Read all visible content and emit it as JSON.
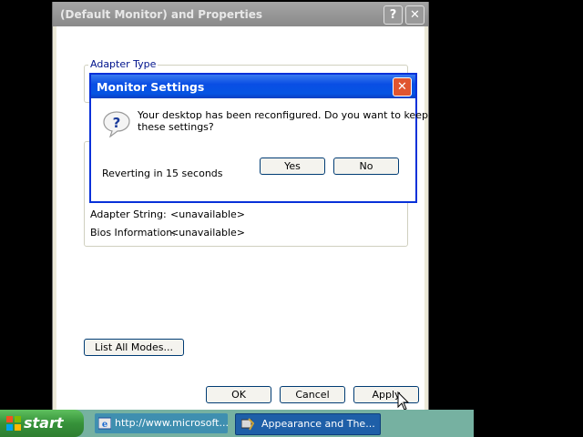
{
  "properties_window": {
    "title": "(Default Monitor) and  Properties",
    "help_button": "?",
    "close_button": "✕",
    "adapter_type_label": "Adapter Type",
    "info_rows": [
      {
        "label": "Adapter String:",
        "value": "<unavailable>"
      },
      {
        "label": "Bios Information:",
        "value": "<unavailable>"
      }
    ],
    "list_all_modes_label": "List All Modes...",
    "ok_label": "OK",
    "cancel_label": "Cancel",
    "apply_label": "Apply"
  },
  "dialog": {
    "title": "Monitor Settings",
    "close_button": "✕",
    "icon_glyph": "?",
    "message_line1": "Your desktop has been reconfigured.  Do you want to keep",
    "message_line2": "these settings?",
    "countdown": "Reverting in 15 seconds",
    "yes_label": "Yes",
    "no_label": "No"
  },
  "taskbar": {
    "start_label": "start",
    "tasks": [
      {
        "label": "http://www.microsoft..."
      },
      {
        "label": "Appearance and The..."
      }
    ]
  },
  "colors": {
    "dialog_title": "#0a4ee4",
    "taskbar": "#76b1a1",
    "start_button": "#36923a"
  }
}
